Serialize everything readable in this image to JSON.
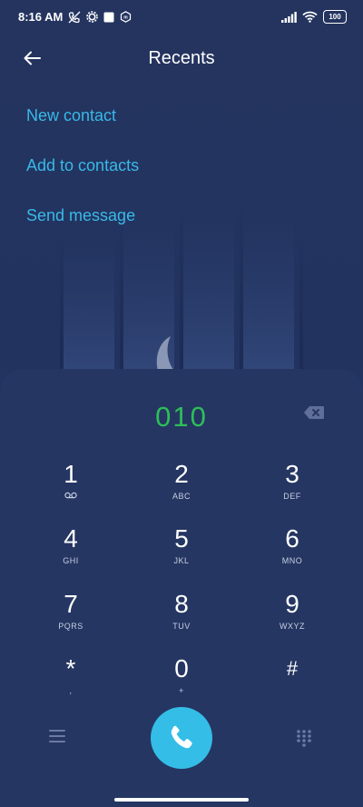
{
  "status_bar": {
    "time": "8:16 AM",
    "battery": "100"
  },
  "header": {
    "title": "Recents"
  },
  "menu": {
    "items": [
      "New contact",
      "Add to contacts",
      "Send message"
    ]
  },
  "dialer": {
    "number": "010",
    "keys": [
      {
        "digit": "1",
        "sub": ""
      },
      {
        "digit": "2",
        "sub": "ABC"
      },
      {
        "digit": "3",
        "sub": "DEF"
      },
      {
        "digit": "4",
        "sub": "GHI"
      },
      {
        "digit": "5",
        "sub": "JKL"
      },
      {
        "digit": "6",
        "sub": "MNO"
      },
      {
        "digit": "7",
        "sub": "PQRS"
      },
      {
        "digit": "8",
        "sub": "TUV"
      },
      {
        "digit": "9",
        "sub": "WXYZ"
      },
      {
        "digit": "*",
        "sub": ","
      },
      {
        "digit": "0",
        "sub": "+"
      },
      {
        "digit": "#",
        "sub": ""
      }
    ]
  },
  "icons": {
    "back": "arrow-left-icon",
    "backspace": "backspace-icon",
    "call": "phone-icon",
    "menu": "hamburger-icon",
    "keypad": "keypad-icon"
  },
  "colors": {
    "accent": "#39b9e8",
    "number": "#2ebe5a",
    "call_button": "#34bde6",
    "panel": "#253662"
  }
}
